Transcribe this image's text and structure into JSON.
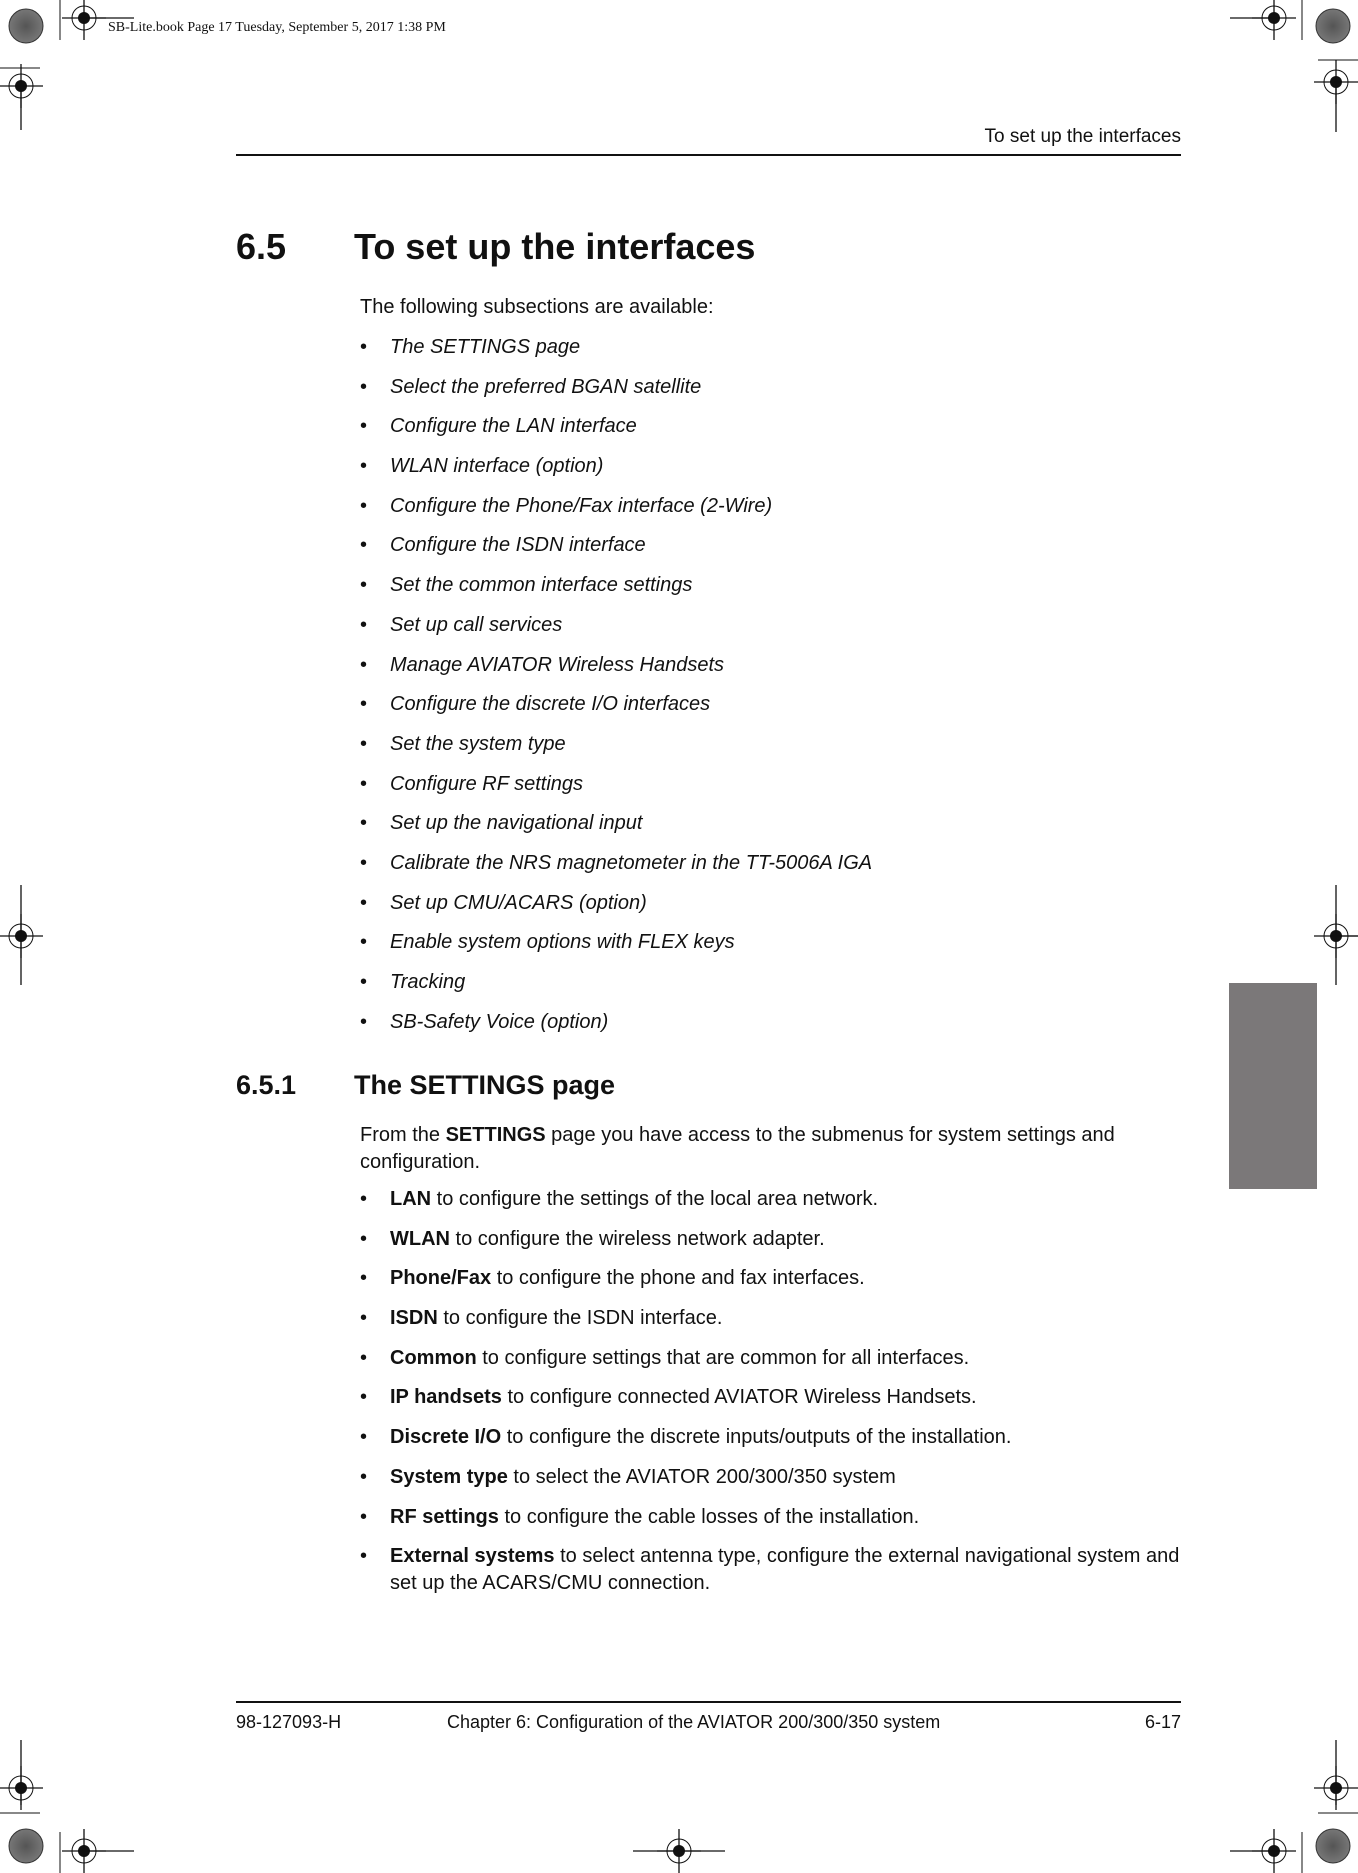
{
  "slug": "SB-Lite.book  Page 17  Tuesday, September 5, 2017  1:38 PM",
  "header": {
    "running_title": "To set up the interfaces"
  },
  "section": {
    "number": "6.5",
    "title": "To set up the interfaces",
    "intro": "The following subsections are available:",
    "subsections": [
      "The SETTINGS page",
      "Select the preferred BGAN satellite",
      "Configure the LAN interface",
      "WLAN interface (option)",
      "Configure the Phone/Fax interface (2-Wire)",
      "Configure the ISDN interface",
      "Set the common interface settings",
      "Set up call services",
      "Manage AVIATOR Wireless Handsets",
      "Configure the discrete I/O interfaces",
      "Set the system type",
      "Configure RF settings",
      "Set up the navigational input",
      "Calibrate the NRS magnetometer in the TT-5006A IGA",
      "Set up CMU/ACARS (option)",
      "Enable system options with FLEX keys",
      "Tracking",
      "SB-Safety Voice (option)"
    ]
  },
  "subsection": {
    "number": "6.5.1",
    "title": "The SETTINGS page",
    "para_prefix": "From the ",
    "para_bold": "SETTINGS",
    "para_suffix": " page you have access to the submenus for system settings and configuration.",
    "items": [
      {
        "term": "LAN",
        "desc": " to configure the settings of the local area network."
      },
      {
        "term": "WLAN",
        "desc": " to configure the wireless network adapter."
      },
      {
        "term": "Phone/Fax",
        "desc": " to configure the phone and fax interfaces."
      },
      {
        "term": "ISDN",
        "desc": " to configure the ISDN interface."
      },
      {
        "term": "Common",
        "desc": " to configure settings that are common for all interfaces."
      },
      {
        "term": "IP handsets",
        "desc": " to configure connected AVIATOR Wireless Handsets."
      },
      {
        "term": "Discrete I/O",
        "desc": " to configure the discrete inputs/outputs of the installation."
      },
      {
        "term": "System type",
        "desc": " to select the AVIATOR 200/300/350 system"
      },
      {
        "term": "RF settings",
        "desc": " to configure the cable losses of the installation."
      },
      {
        "term": "External systems",
        "desc": " to select antenna type, configure the external navigational system and set up the ACARS/CMU connection."
      }
    ]
  },
  "footer": {
    "doc_number": "98-127093-H",
    "chapter": "Chapter 6:  Configuration of the AVIATOR 200/300/350 system",
    "page": "6-17"
  },
  "colors": {
    "thumb_tab": "#7b7879",
    "text": "#111111"
  }
}
